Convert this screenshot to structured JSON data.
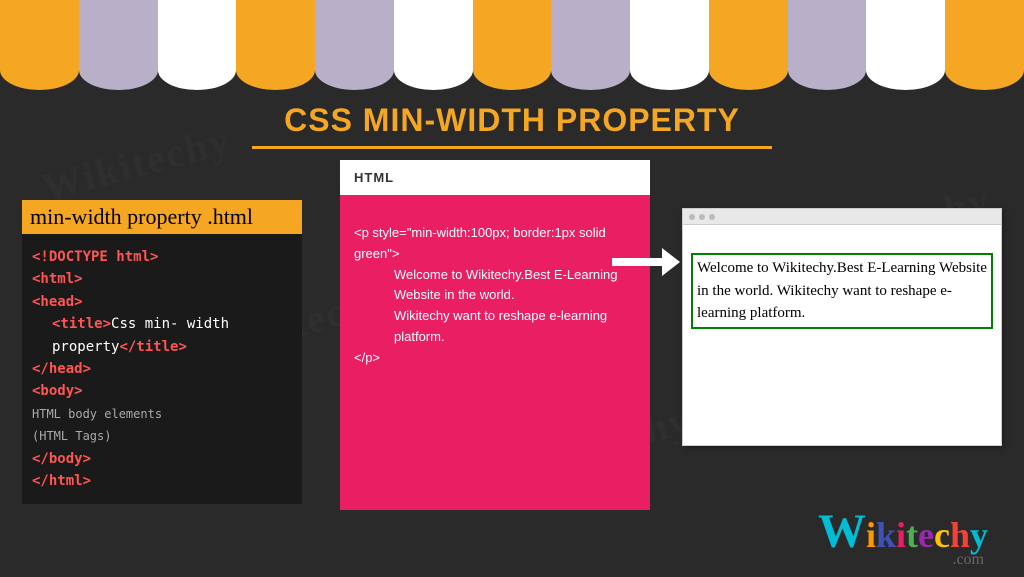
{
  "title": "CSS MIN-WIDTH PROPERTY",
  "codePanel": {
    "filename": "min-width property .html",
    "doctype": "<!DOCTYPE html>",
    "htmlOpen": "<html>",
    "headOpen": "<head>",
    "titleOpen": "<title>",
    "titleText": "Css min- width property",
    "titleClose": "</title>",
    "headClose": "</head>",
    "bodyOpen": "<body>",
    "bodyText1": "HTML body elements",
    "bodyText2": "(HTML Tags)",
    "bodyClose": "</body>",
    "htmlClose": "</html>"
  },
  "htmlPanel": {
    "header": "HTML",
    "line1": "<p style=\"min-width:100px; border:1px solid green\">",
    "line2": "Welcome to Wikitechy.Best E-Learning Website in the world.",
    "line3": "Wikitechy want to reshape e-learning platform.",
    "line4": "</p>"
  },
  "browser": {
    "text": "Welcome to Wikitechy.Best E-Learning Website in the world. Wikitechy want to reshape e-learning platform."
  },
  "logo": {
    "letters": {
      "w": "W",
      "i1": "i",
      "k": "k",
      "i2": "i",
      "t": "t",
      "e": "e",
      "c": "c",
      "h": "h",
      "y": "y"
    },
    "com": ".com"
  }
}
